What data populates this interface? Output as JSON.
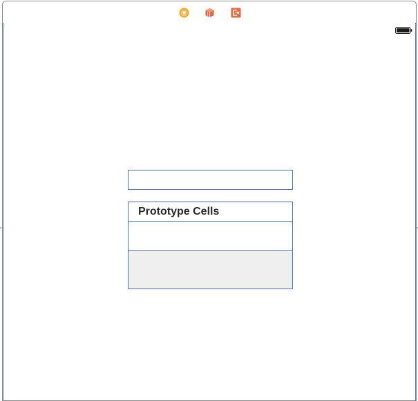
{
  "scene": {
    "dock": {
      "icons": [
        "view-controller-icon",
        "first-responder-icon",
        "exit-icon"
      ],
      "colors": {
        "view_controller": "#f5a623",
        "first_responder": "#e8683f",
        "exit": "#e8683f"
      }
    },
    "status_bar": {
      "battery_icon": "battery-icon"
    },
    "table": {
      "header_label": "Prototype Cells"
    },
    "colors": {
      "selection_border": "#4a72c0",
      "empty_table_bg": "#efefef"
    }
  }
}
